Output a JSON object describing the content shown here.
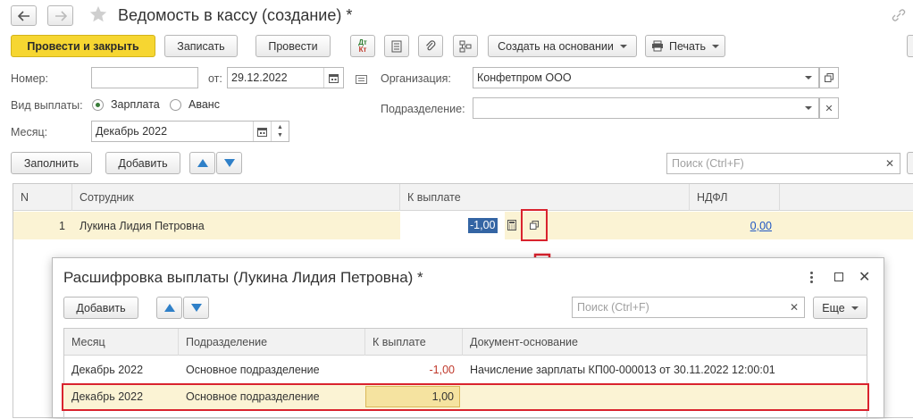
{
  "window": {
    "title": "Ведомость в кассу (создание) *"
  },
  "toolbar": {
    "post_close": "Провести и закрыть",
    "save": "Записать",
    "post": "Провести",
    "dt_kt": "Дт Кт",
    "create_based": "Создать на основании",
    "print": "Печать"
  },
  "form": {
    "number_label": "Номер:",
    "number_value": "",
    "from_label": "от:",
    "date_value": "29.12.2022",
    "org_label": "Организация:",
    "org_value": "Конфетпром ООО",
    "payment_type_label": "Вид выплаты:",
    "salary_option": "Зарплата",
    "advance_option": "Аванс",
    "department_label": "Подразделение:",
    "department_value": "",
    "month_label": "Месяц:",
    "month_value": "Декабрь 2022"
  },
  "table_toolbar": {
    "fill": "Заполнить",
    "add": "Добавить",
    "search_placeholder": "Поиск (Ctrl+F)"
  },
  "table": {
    "columns": [
      "N",
      "Сотрудник",
      "К выплате",
      "НДФЛ"
    ],
    "rows": [
      {
        "n": "1",
        "employee": "Лукина Лидия Петровна",
        "payout": "-1,00",
        "ndfl": "0,00"
      }
    ]
  },
  "dialog": {
    "title": "Расшифровка выплаты (Лукина Лидия Петровна) *",
    "add": "Добавить",
    "search_placeholder": "Поиск (Ctrl+F)",
    "more": "Еще",
    "columns": [
      "Месяц",
      "Подразделение",
      "К выплате",
      "Документ-основание"
    ],
    "rows": [
      {
        "month": "Декабрь 2022",
        "department": "Основное подразделение",
        "payout": "-1,00",
        "basis": "Начисление зарплаты КП00-000013 от 30.11.2022 12:00:01"
      },
      {
        "month": "Декабрь 2022",
        "department": "Основное подразделение",
        "payout": "1,00",
        "basis": ""
      }
    ]
  },
  "colors": {
    "accent_yellow": "#f6d631",
    "row_highlight": "#fbf3d4",
    "annotation_red": "#d9232e",
    "negative_red": "#c0392b",
    "link_blue": "#1f57c3"
  },
  "icons": [
    "back-arrow-icon",
    "forward-arrow-icon",
    "star-icon",
    "link-icon",
    "table-list-icon",
    "paperclip-icon",
    "structure-icon",
    "printer-icon",
    "calendar-icon",
    "open-icon",
    "calculator-icon",
    "kebab-menu-icon",
    "maximize-icon",
    "close-icon",
    "down-arrow-annotation-icon"
  ]
}
